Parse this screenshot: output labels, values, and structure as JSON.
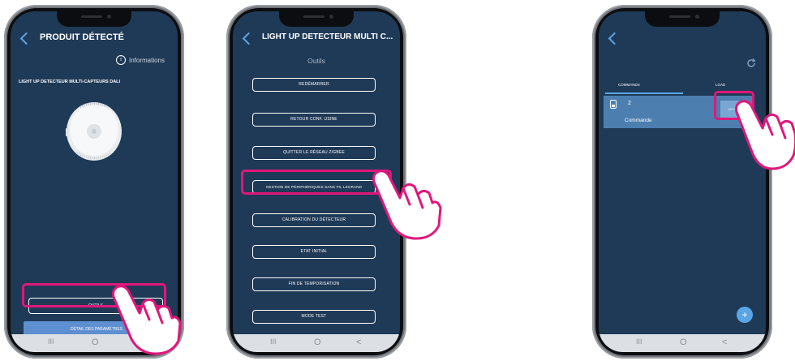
{
  "phone1": {
    "title": "PRODUIT DÉTECTÉ",
    "info_label": "Informations",
    "product_name": "LIGHT UP DETECTEUR MULTI-CAPTEURS DALI",
    "tools_button": "OUTILS",
    "params_button": "DÉTAIL DES PARAMÈTRES"
  },
  "phone2": {
    "title": "LIGHT UP DETECTEUR MULTI C...",
    "subtitle": "Outils",
    "buttons": [
      "REDÉMARRER",
      "RETOUR CONF. USINE",
      "QUITTER LE RÉSEAU ZIGBEE",
      "GESTION DE PÉRIPHÉRIQUES SANS FIL LEGRAND",
      "CALIBRATION DU DÉTECTEUR",
      "ETAT INITIAL",
      "FIN DE TEMPORISATION",
      "MODE TEST"
    ]
  },
  "phone3": {
    "tab_commands": "COMMANDS",
    "tab_load": "LOAD",
    "row_number": "2",
    "row_label": "Commande",
    "row_action": "LEVER",
    "fab": "+"
  },
  "navbar": {
    "recent": "III",
    "home": "O",
    "back": "<"
  },
  "colors": {
    "screen_bg": "#1f3a57",
    "accent": "#5aa5e6",
    "highlight": "#e0177b",
    "fab": "#5aa5e6"
  }
}
